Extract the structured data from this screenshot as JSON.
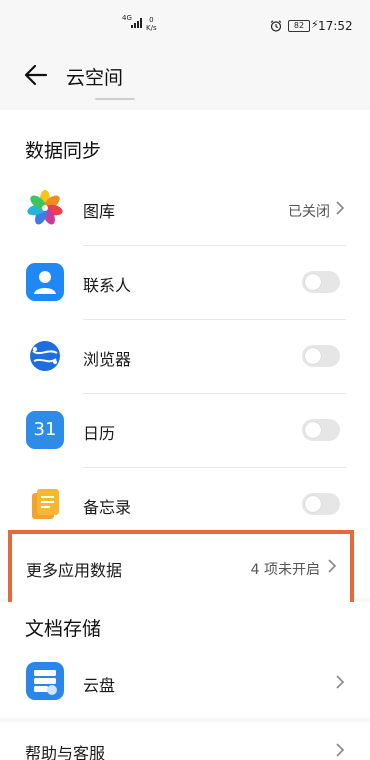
{
  "status_bar": {
    "network": "4G",
    "speed_value": "0",
    "speed_unit": "K/s",
    "battery": "82",
    "time": "17:52"
  },
  "header": {
    "title": "云空间"
  },
  "data_sync": {
    "section_title": "数据同步",
    "items": [
      {
        "label": "图库",
        "value": "已关闭",
        "control": "chevron",
        "icon": "gallery-icon"
      },
      {
        "label": "联系人",
        "control": "toggle",
        "on": false,
        "icon": "contacts-icon"
      },
      {
        "label": "浏览器",
        "control": "toggle",
        "on": false,
        "icon": "browser-icon"
      },
      {
        "label": "日历",
        "control": "toggle",
        "on": false,
        "icon": "calendar-icon",
        "icon_text": "31"
      },
      {
        "label": "备忘录",
        "control": "toggle",
        "on": false,
        "icon": "notepad-icon"
      }
    ],
    "more": {
      "label": "更多应用数据",
      "value": "4 项未开启"
    }
  },
  "doc_storage": {
    "section_title": "文档存储",
    "items": [
      {
        "label": "云盘",
        "icon": "cloud-drive-icon"
      }
    ]
  },
  "help": {
    "label": "帮助与客服"
  },
  "colors": {
    "highlight_border": "#e9683b",
    "toggle_off": "#e6e6e6",
    "page_background": "#f7f7f7"
  }
}
